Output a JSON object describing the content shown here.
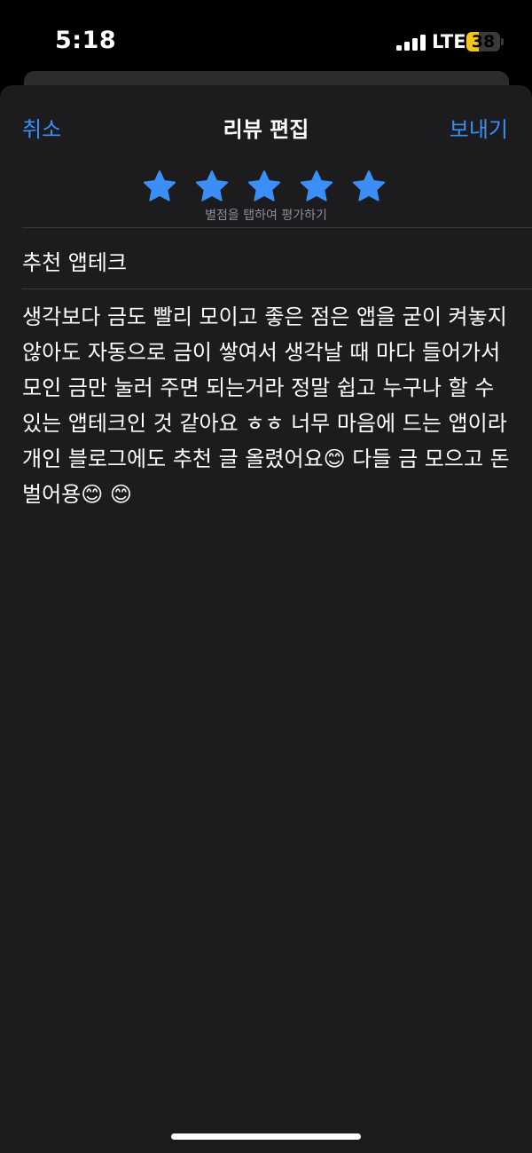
{
  "status_bar": {
    "time": "5:18",
    "network": "LTE",
    "battery": "38",
    "battery_level": 0.38,
    "battery_color": "#f5c518"
  },
  "nav": {
    "cancel_label": "취소",
    "title": "리뷰 편집",
    "send_label": "보내기",
    "accent_color": "#3a8ef6"
  },
  "rating": {
    "stars": 5,
    "max": 5,
    "star_icon": "star-icon",
    "hint": "별점을 탭하여 평가하기"
  },
  "review": {
    "title": "추천 앱테크",
    "body": "생각보다 금도 빨리 모이고 좋은 점은 앱을 굳이 켜놓지 않아도 자동으로 금이 쌓여서 생각날 때 마다 들어가서 모인 금만 눌러 주면 되는거라 정말 쉽고 누구나 할 수 있는 앱테크인 것 같아요 ㅎㅎ 너무 마음에 드는 앱이라 개인 블로그에도 추천 글 올렸어요😊 다들 금 모으고 돈벌어용😊 😊"
  }
}
